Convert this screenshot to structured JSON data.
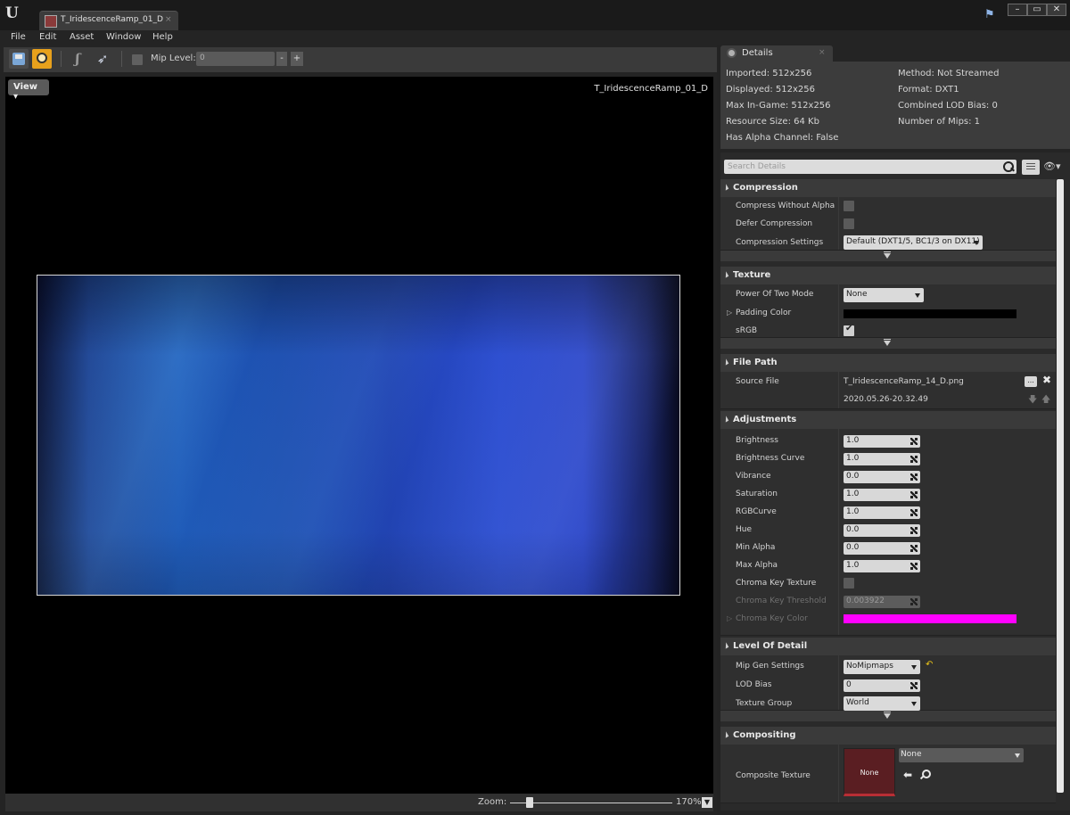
{
  "window": {
    "tab_title": "T_IridescenceRamp_01_D",
    "tab_close": "×"
  },
  "menu": [
    "File",
    "Edit",
    "Asset",
    "Window",
    "Help"
  ],
  "toolbar": {
    "mip_level_label": "Mip Level:",
    "mip_level_value": "0",
    "minus": "-",
    "plus": "+"
  },
  "viewport": {
    "view_label": "View ▾",
    "texture_name": "T_IridescenceRamp_01_D",
    "zoom_label": "Zoom:",
    "zoom_value": "170%",
    "zoom_fraction": 0.12
  },
  "details": {
    "tab_label": "Details",
    "tab_close": "×",
    "info_left": [
      "Imported: 512x256",
      "Displayed: 512x256",
      "Max In-Game: 512x256",
      "Resource Size: 64 Kb",
      "Has Alpha Channel: False"
    ],
    "info_right": [
      "Method: Not Streamed",
      "Format: DXT1",
      "Combined LOD Bias: 0",
      "Number of Mips: 1"
    ],
    "search_placeholder": "Search Details",
    "eye_label": "👁▾",
    "categories": {
      "compression": {
        "title": "Compression",
        "compress_without_alpha": "Compress Without Alpha",
        "defer_compression": "Defer Compression",
        "compression_settings": "Compression Settings",
        "compression_settings_value": "Default (DXT1/5, BC1/3 on DX11)"
      },
      "texture": {
        "title": "Texture",
        "power_of_two_mode": "Power Of Two Mode",
        "power_of_two_value": "None",
        "padding_color": "Padding Color",
        "padding_color_hex": "#000000",
        "srgb": "sRGB"
      },
      "file_path": {
        "title": "File Path",
        "source_file": "Source File",
        "source_file_value": "T_IridescenceRamp_14_D.png",
        "timestamp": "2020.05.26-20.32.49",
        "browse_label": "...",
        "clear_label": "✖"
      },
      "adjustments": {
        "title": "Adjustments",
        "rows": [
          {
            "label": "Brightness",
            "value": "1.0"
          },
          {
            "label": "Brightness Curve",
            "value": "1.0"
          },
          {
            "label": "Vibrance",
            "value": "0.0"
          },
          {
            "label": "Saturation",
            "value": "1.0"
          },
          {
            "label": "RGBCurve",
            "value": "1.0"
          },
          {
            "label": "Hue",
            "value": "0.0"
          },
          {
            "label": "Min Alpha",
            "value": "0.0"
          },
          {
            "label": "Max Alpha",
            "value": "1.0"
          }
        ],
        "chroma_key_texture": "Chroma Key Texture",
        "chroma_key_threshold": "Chroma Key Threshold",
        "chroma_key_threshold_value": "0.003922",
        "chroma_key_color": "Chroma Key Color",
        "chroma_key_color_hex": "#ff00ff"
      },
      "level_of_detail": {
        "title": "Level Of Detail",
        "mip_gen_settings": "Mip Gen Settings",
        "mip_gen_value": "NoMipmaps",
        "lod_bias": "LOD Bias",
        "lod_bias_value": "0",
        "texture_group": "Texture Group",
        "texture_group_value": "World"
      },
      "compositing": {
        "title": "Compositing",
        "composite_texture": "Composite Texture",
        "thumb_label": "None",
        "dropdown_value": "None"
      }
    }
  },
  "colors": {
    "accent_orange": "#e8a11c",
    "panel_bg": "#2a2a2a",
    "header_bg": "#3a3a3a"
  }
}
